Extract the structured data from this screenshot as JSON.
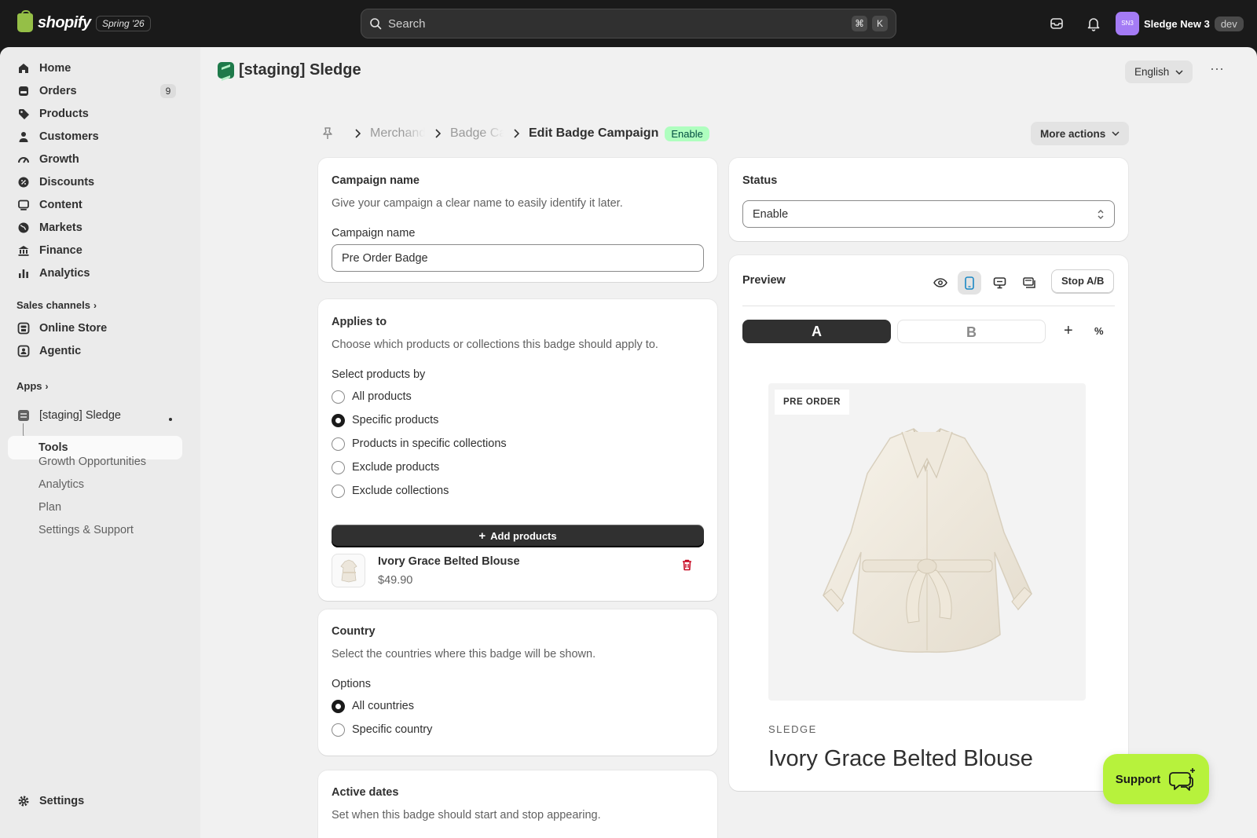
{
  "topbar": {
    "brand": "shopify",
    "version": "Spring '26",
    "search_placeholder": "Search",
    "shortcut_cmd": "⌘",
    "shortcut_key": "K",
    "store_initials": "SN3",
    "store_name": "Sledge New 3",
    "env_badge": "dev"
  },
  "sidebar": {
    "items": [
      {
        "label": "Home",
        "icon": "home-icon"
      },
      {
        "label": "Orders",
        "icon": "orders-icon",
        "count": "9"
      },
      {
        "label": "Products",
        "icon": "tag-icon"
      },
      {
        "label": "Customers",
        "icon": "person-icon"
      },
      {
        "label": "Growth",
        "icon": "gauge-icon"
      },
      {
        "label": "Discounts",
        "icon": "discount-icon"
      },
      {
        "label": "Content",
        "icon": "content-icon"
      },
      {
        "label": "Markets",
        "icon": "globe-icon"
      },
      {
        "label": "Finance",
        "icon": "bank-icon"
      },
      {
        "label": "Analytics",
        "icon": "bar-chart-icon"
      }
    ],
    "sales_channels_label": "Sales channels",
    "channels": [
      {
        "label": "Online Store",
        "icon": "store-icon"
      },
      {
        "label": "Agentic",
        "icon": "agentic-icon"
      }
    ],
    "apps_label": "Apps",
    "app_name": "[staging] Sledge",
    "app_subitems": [
      "Tools",
      "Growth Opportunities",
      "Analytics",
      "Plan",
      "Settings & Support"
    ],
    "settings_label": "Settings"
  },
  "header": {
    "app_title": "[staging] Sledge",
    "language": "English"
  },
  "breadcrumb": {
    "items": [
      "Merchandising",
      "Badge Campaigns"
    ],
    "current": "Edit Badge Campaign",
    "status": "Enable",
    "more_actions": "More actions"
  },
  "campaign_name": {
    "title": "Campaign name",
    "description": "Give your campaign a clear name to easily identify it later.",
    "field_label": "Campaign name",
    "value": "Pre Order Badge"
  },
  "applies_to": {
    "title": "Applies to",
    "description": "Choose which products or collections this badge should apply to.",
    "select_label": "Select products by",
    "options": [
      "All products",
      "Specific products",
      "Products in specific collections",
      "Exclude products",
      "Exclude collections"
    ],
    "selected_index": 1,
    "add_button": "Add products",
    "product": {
      "name": "Ivory Grace Belted Blouse",
      "price": "$49.90"
    }
  },
  "country": {
    "title": "Country",
    "description": "Select the countries where this badge will be shown.",
    "options_label": "Options",
    "options": [
      "All countries",
      "Specific country"
    ],
    "selected_index": 0
  },
  "active_dates": {
    "title": "Active dates",
    "description": "Set when this badge should start and stop appearing."
  },
  "status_card": {
    "title": "Status",
    "value": "Enable"
  },
  "preview": {
    "title": "Preview",
    "stop_ab": "Stop A/B",
    "tab_a": "A",
    "tab_b": "B",
    "plus": "+",
    "percent": "%",
    "badge_text": "PRE ORDER",
    "vendor": "SLEDGE",
    "product_title": "Ivory Grace Belted Blouse"
  },
  "support": {
    "label": "Support"
  },
  "colors": {
    "accent_green": "#affebf",
    "support_lime": "#b7f23c",
    "dark": "#303030"
  }
}
